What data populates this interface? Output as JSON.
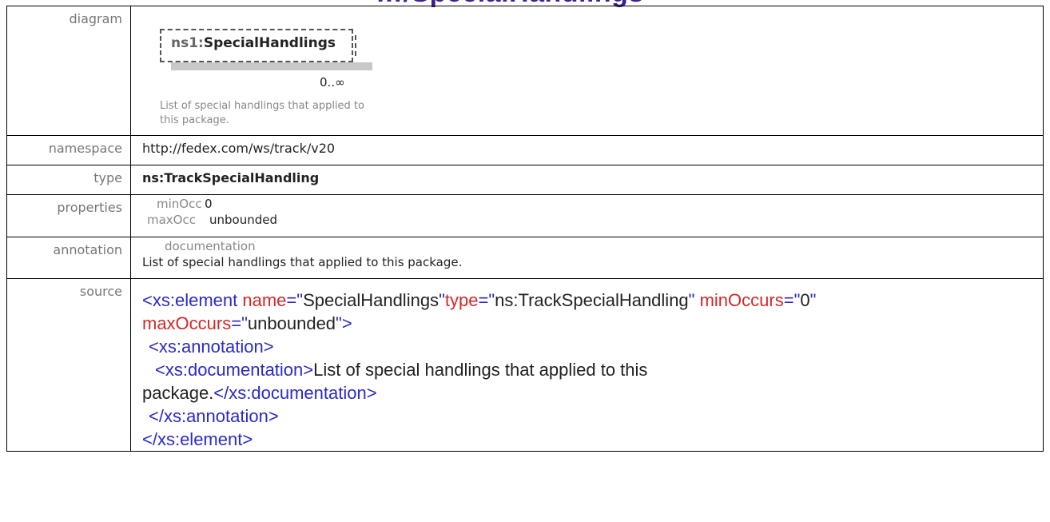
{
  "heading_fragment": "…/SpecialHandlings",
  "rows": {
    "diagram_label": "diagram",
    "namespace_label": "namespace",
    "type_label": "type",
    "properties_label": "properties",
    "annotation_label": "annotation",
    "source_label": "source"
  },
  "diagram": {
    "element_prefix": "ns1:",
    "element_name": "SpecialHandlings",
    "occurrence": "0..∞",
    "description": "List of special handlings that applied to this package."
  },
  "namespace": "http://fedex.com/ws/track/v20",
  "type": "ns:TrackSpecialHandling",
  "properties": {
    "min_label": "minOcc",
    "min_value": "0",
    "max_label": "maxOcc",
    "max_value": "unbounded"
  },
  "annotation": {
    "heading": "documentation",
    "text": "List of special handlings that applied to this package."
  },
  "source": {
    "l1_open": "<xs:element",
    "l1_attr1": " name",
    "l1_eq1": "=\"",
    "l1_val1": "SpecialHandlings",
    "l1_q1": "\"",
    "l1_attr2": "type",
    "l1_eq2": "=\"",
    "l1_val2": "ns:TrackSpecialHandling",
    "l1_q2": "\"",
    "l1_attr3": " minOccurs",
    "l1_eq3": "=\"",
    "l1_val3": "0",
    "l1_q3": "\"",
    "l2_attr": "maxOccurs",
    "l2_eq": "=\"",
    "l2_val": "unbounded",
    "l2_close": "\">",
    "l3": "<xs:annotation>",
    "l4_open": "<xs:documentation>",
    "l4_text": "List of special handlings that applied to this",
    "l5_text": "package.",
    "l5_close": "</xs:documentation>",
    "l6": "</xs:annotation>",
    "l7": "</xs:element>"
  }
}
